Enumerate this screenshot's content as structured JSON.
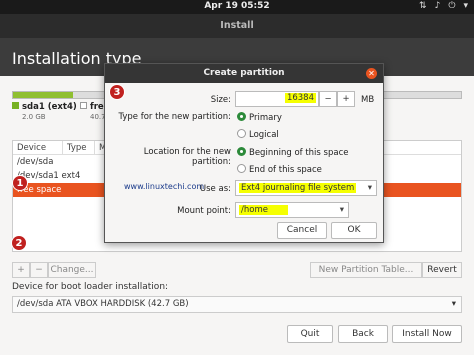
{
  "topbar": {
    "clock": "Apr 19  05:52"
  },
  "window": {
    "title": "Install",
    "heading": "Installation type"
  },
  "legend": [
    {
      "name": "sda1 (ext4)",
      "size": "2.0 GB"
    },
    {
      "name": "free",
      "size": "40.7"
    }
  ],
  "table": {
    "columns": [
      "Device",
      "Type",
      "M"
    ],
    "rows": [
      "/dev/sda",
      "/dev/sda1  ext4",
      "free space"
    ]
  },
  "buttons": {
    "add": "+",
    "remove": "−",
    "change": "Change...",
    "new_table": "New Partition Table...",
    "revert": "Revert",
    "quit": "Quit",
    "back": "Back",
    "install": "Install Now"
  },
  "boot": {
    "label": "Device for boot loader installation:",
    "value": "/dev/sda   ATA VBOX HARDDISK (42.7 GB)"
  },
  "dialog": {
    "title": "Create partition",
    "size_label": "Size:",
    "size_value": "16384",
    "size_unit": "MB",
    "type_label": "Type for the new partition:",
    "type_options": [
      "Primary",
      "Logical"
    ],
    "location_label": "Location for the new partition:",
    "location_options": [
      "Beginning of this space",
      "End of this space"
    ],
    "use_as_label": "Use as:",
    "use_as_value": "Ext4 journaling file system",
    "mount_label": "Mount point:",
    "mount_value": "/home",
    "cancel": "Cancel",
    "ok": "OK",
    "watermark": "www.linuxtechi.com"
  },
  "markers": [
    "1",
    "2",
    "3"
  ],
  "colors": {
    "accent": "#e95420",
    "highlight": "#f5ff00",
    "marker": "#c0211f"
  }
}
